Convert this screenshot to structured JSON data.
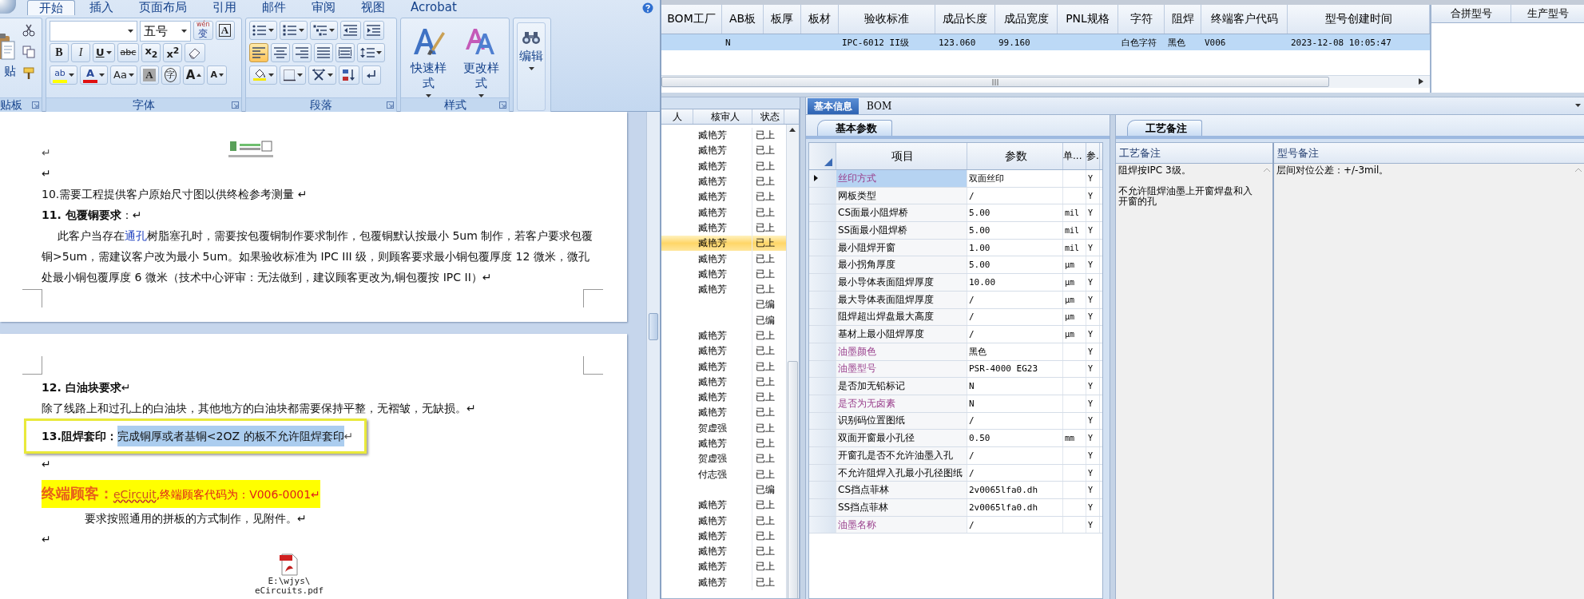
{
  "word": {
    "ribbon": {
      "tabs": [
        {
          "label": "开始",
          "selected": true
        },
        {
          "label": "插入",
          "selected": false
        },
        {
          "label": "页面布局",
          "selected": false
        },
        {
          "label": "引用",
          "selected": false
        },
        {
          "label": "邮件",
          "selected": false
        },
        {
          "label": "审阅",
          "selected": false
        },
        {
          "label": "视图",
          "selected": false
        },
        {
          "label": "Acrobat",
          "selected": false
        }
      ],
      "groups": [
        {
          "kind": "clipboard",
          "label": "贴板",
          "large": [
            {
              "kind": "paste",
              "label": "贴"
            }
          ],
          "rows": [
            {
              "tools": [
                {
                  "kind": "cut"
                }
              ]
            },
            {
              "tools": [
                {
                  "kind": "copy"
                }
              ]
            },
            {
              "tools": [
                {
                  "kind": "painter"
                }
              ]
            }
          ]
        },
        {
          "kind": "font",
          "label": "字体",
          "rows": [
            {
              "tools": [
                {
                  "kind": "field",
                  "dropdown": true
                },
                {
                  "kind": "field",
                  "value": "五号",
                  "dropdown": true
                },
                {
                  "kind": "phonetic",
                  "label": "变",
                  "ruby": "wén",
                  "dropdown": false
                },
                {
                  "kind": "char-border",
                  "label": "A",
                  "dropdown": false
                }
              ]
            },
            {
              "tools": [
                {
                  "kind": "bold",
                  "label": "B",
                  "dropdown": false
                },
                {
                  "kind": "italic",
                  "label": "I",
                  "dropdown": false
                },
                {
                  "kind": "underline",
                  "label": "U",
                  "dropdown": true
                },
                {
                  "kind": "strike",
                  "label": "abc",
                  "dropdown": false
                },
                {
                  "kind": "sub",
                  "label": "x$_{2}$",
                  "dropdown": false
                },
                {
                  "kind": "sup",
                  "label": "x$^{2}$",
                  "dropdown": false
                },
                {
                  "kind": "eraser",
                  "dropdown": false
                }
              ]
            },
            {
              "tools": [
                {
                  "kind": "highlight",
                  "label": "ab",
                  "dropdown": true
                },
                {
                  "kind": "font-color",
                  "label": "A",
                  "dropdown": true
                },
                {
                  "kind": "case",
                  "label": "Aa",
                  "dropdown": true
                },
                {
                  "kind": "shade",
                  "label": "A",
                  "dropdown": false
                },
                {
                  "kind": "enclose",
                  "label": "字",
                  "dropdown": false
                },
                {
                  "kind": "grow",
                  "label": "A",
                  "dropdown": false
                },
                {
                  "kind": "shrink",
                  "label": "A",
                  "dropdown": false
                }
              ]
            }
          ]
        },
        {
          "kind": "paragraph",
          "label": "段落",
          "rows": [
            {
              "tools": [
                {
                  "kind": "bullets",
                  "dropdown": true
                },
                {
                  "kind": "numbering",
                  "dropdown": true
                },
                {
                  "kind": "multilevel",
                  "dropdown": true
                },
                {
                  "kind": "outdent",
                  "dropdown": false
                },
                {
                  "kind": "indent",
                  "dropdown": false
                }
              ]
            },
            {
              "tools": [
                {
                  "kind": "align-left",
                  "dropdown": false,
                  "selected": true
                },
                {
                  "kind": "align-center",
                  "dropdown": false,
                  "selected": false
                },
                {
                  "kind": "align-right",
                  "dropdown": false,
                  "selected": false
                },
                {
                  "kind": "justify",
                  "dropdown": false,
                  "selected": false
                },
                {
                  "kind": "distribute",
                  "dropdown": false,
                  "selected": false
                },
                {
                  "kind": "line-spacing",
                  "dropdown": true
                }
              ]
            },
            {
              "tools": [
                {
                  "kind": "shading",
                  "dropdown": true
                },
                {
                  "kind": "borders",
                  "dropdown": true
                },
                {
                  "kind": "asian-layout",
                  "dropdown": true
                },
                {
                  "kind": "sort",
                  "dropdown": false
                },
                {
                  "kind": "marks",
                  "dropdown": false
                }
              ]
            }
          ]
        },
        {
          "kind": "styles",
          "label": "样式",
          "large": [
            {
              "kind": "quick-styles",
              "label": "快速样式"
            },
            {
              "kind": "change-styles",
              "label": "更改样式"
            }
          ]
        },
        {
          "kind": "editing",
          "large": [
            {
              "kind": "find",
              "label": "编辑"
            }
          ]
        }
      ]
    },
    "pages": [
      {
        "blocks": [
          {
            "kind": "embed",
            "text": "↵"
          },
          {
            "kind": "para",
            "text": "↵"
          },
          {
            "kind": "para",
            "text": "10.需要工程提供客户原始尺寸图以供终检参考测量 ↵"
          },
          {
            "kind": "para",
            "text": "**11. 包覆铜要求**：↵"
          },
          {
            "kind": "link-para",
            "before": "此客户当存在",
            "link": "通孔",
            "after": "树脂塞孔时，需要按包覆铜制作要求制作，包覆铜默认按最小 5um 制作，若客户要求包覆铜>5um，需建议客户改为最小 5um。如果验收标准为 IPC III 级，则顾客要求最小铜包覆厚度 12 微米，微孔处最小铜包覆厚度 6 微米（技术中心评审：无法做到，建议顾客更改为,铜包覆按 IPC II）↵"
          }
        ]
      },
      {
        "blocks": [
          {
            "kind": "para",
            "text": "**12. 白油块要求**↵"
          },
          {
            "kind": "para",
            "text": "除了线路上和过孔上的白油块，其他地方的白油块都需要保持平整，无褶皱，无缺损。↵"
          },
          {
            "kind": "boxed",
            "label": "13.阻焊套印：",
            "selection": "完成铜厚或者基铜<2OZ 的板不允许阻焊套印",
            "end": "↵"
          },
          {
            "kind": "para",
            "text": "↵"
          },
          {
            "kind": "highlight",
            "lead": "终端顾客：",
            "link": "eCircuit",
            "after": ",终端顾客代码为：V006-0001↵"
          },
          {
            "kind": "indented",
            "text": "要求按照通用的拼板的方式制作，见附件。↵"
          },
          {
            "kind": "para",
            "text": "↵"
          },
          {
            "kind": "attachment",
            "lines": [
              "E:\\wjys\\",
              "eCircuits.pdf"
            ]
          }
        ]
      }
    ]
  },
  "grid": {
    "columns": [
      "BOM工厂",
      "AB板",
      "板厚",
      "板材",
      "验收标准",
      "成品长度",
      "成品宽度",
      "PNL规格",
      "字符",
      "阻焊",
      "终端客户代码",
      "型号创建时间"
    ],
    "rows": [
      {
        "selected": true,
        "cells": [
          null,
          "N",
          null,
          null,
          "IPC-6012 II级",
          "123.060",
          "99.160",
          null,
          "白色字符",
          "黑色",
          "V006",
          "2023-12-08 10:05:47"
        ]
      }
    ]
  },
  "side_grid": {
    "columns": [
      "合拼型号",
      "生产型号"
    ]
  },
  "review_list": {
    "columns": [
      "人",
      "核审人",
      "状态"
    ],
    "rows": [
      {
        "reviewer": "臧艳芳",
        "status": "已上",
        "selected": false
      },
      {
        "reviewer": "臧艳芳",
        "status": "已上",
        "selected": false
      },
      {
        "reviewer": "臧艳芳",
        "status": "已上",
        "selected": false
      },
      {
        "reviewer": "臧艳芳",
        "status": "已上",
        "selected": false
      },
      {
        "reviewer": "臧艳芳",
        "status": "已上",
        "selected": false
      },
      {
        "reviewer": "臧艳芳",
        "status": "已上",
        "selected": false
      },
      {
        "reviewer": "臧艳芳",
        "status": "已上",
        "selected": false
      },
      {
        "reviewer": "臧艳芳",
        "status": "已上",
        "selected": true
      },
      {
        "reviewer": "臧艳芳",
        "status": "已上",
        "selected": false
      },
      {
        "reviewer": "臧艳芳",
        "status": "已上",
        "selected": false
      },
      {
        "reviewer": "臧艳芳",
        "status": "已上",
        "selected": false
      },
      {
        "status": "已编",
        "selected": false
      },
      {
        "status": "已编",
        "selected": false
      },
      {
        "reviewer": "臧艳芳",
        "status": "已上",
        "selected": false
      },
      {
        "reviewer": "臧艳芳",
        "status": "已上",
        "selected": false
      },
      {
        "reviewer": "臧艳芳",
        "status": "已上",
        "selected": false
      },
      {
        "reviewer": "臧艳芳",
        "status": "已上",
        "selected": false
      },
      {
        "reviewer": "臧艳芳",
        "status": "已上",
        "selected": false
      },
      {
        "reviewer": "臧艳芳",
        "status": "已上",
        "selected": false
      },
      {
        "reviewer": "贺虚强",
        "status": "已上",
        "selected": false
      },
      {
        "reviewer": "臧艳芳",
        "status": "已上",
        "selected": false
      },
      {
        "reviewer": "贺虚强",
        "status": "已上",
        "selected": false
      },
      {
        "reviewer": "付志强",
        "status": "已上",
        "selected": false
      },
      {
        "status": "已编",
        "selected": false
      },
      {
        "reviewer": "臧艳芳",
        "status": "已上",
        "selected": false
      },
      {
        "reviewer": "臧艳芳",
        "status": "已上",
        "selected": false
      },
      {
        "reviewer": "臧艳芳",
        "status": "已上",
        "selected": false
      },
      {
        "reviewer": "臧艳芳",
        "status": "已上",
        "selected": false
      },
      {
        "reviewer": "臧艳芳",
        "status": "已上",
        "selected": false
      },
      {
        "reviewer": "臧艳芳",
        "status": "已上",
        "selected": false
      }
    ]
  },
  "detail": {
    "tabs": [
      {
        "label": "基本信息",
        "selected": true
      },
      {
        "label": "BOM",
        "selected": false
      }
    ],
    "params": {
      "tab": "基本参数",
      "columns": [
        "项目",
        "参数",
        "单...",
        "参."
      ],
      "rows": [
        {
          "item": "丝印方式",
          "value": "双面丝印",
          "flag": "Y",
          "accent": true,
          "selected": true
        },
        {
          "item": "网板类型",
          "value": "/",
          "flag": "Y",
          "accent": false,
          "selected": false
        },
        {
          "item": "CS面最小阻焊桥",
          "value": "5.00",
          "unit": "mil",
          "flag": "Y",
          "accent": false,
          "selected": false
        },
        {
          "item": "SS面最小阻焊桥",
          "value": "5.00",
          "unit": "mil",
          "flag": "Y",
          "accent": false,
          "selected": false
        },
        {
          "item": "最小阻焊开窗",
          "value": "1.00",
          "unit": "mil",
          "flag": "Y",
          "accent": false,
          "selected": false
        },
        {
          "item": "最小拐角厚度",
          "value": "5.00",
          "unit": "μm",
          "flag": "Y",
          "accent": false,
          "selected": false
        },
        {
          "item": "最小导体表面阻焊厚度",
          "value": "10.00",
          "unit": "μm",
          "flag": "Y",
          "accent": false,
          "selected": false
        },
        {
          "item": "最大导体表面阻焊厚度",
          "value": "/",
          "unit": "μm",
          "flag": "Y",
          "accent": false,
          "selected": false
        },
        {
          "item": "阻焊超出焊盘最大高度",
          "value": "/",
          "unit": "μm",
          "flag": "Y",
          "accent": false,
          "selected": false
        },
        {
          "item": "基材上最小阻焊厚度",
          "value": "/",
          "unit": "μm",
          "flag": "Y",
          "accent": false,
          "selected": false
        },
        {
          "item": "油墨颜色",
          "value": "黑色",
          "flag": "Y",
          "accent": true,
          "selected": false
        },
        {
          "item": "油墨型号",
          "value": "PSR-4000 EG23",
          "flag": "Y",
          "accent": true,
          "selected": false
        },
        {
          "item": "是否加无铅标记",
          "value": "N",
          "flag": "Y",
          "accent": false,
          "selected": false
        },
        {
          "item": "是否为无卤素",
          "value": "N",
          "flag": "Y",
          "accent": true,
          "selected": false
        },
        {
          "item": "识别码位置图纸",
          "value": "/",
          "flag": "Y",
          "accent": false,
          "selected": false
        },
        {
          "item": "双面开窗最小孔径",
          "value": "0.50",
          "unit": "mm",
          "flag": "Y",
          "accent": false,
          "selected": false
        },
        {
          "item": "开窗孔是否不允许油墨入孔",
          "value": "/",
          "flag": "Y",
          "accent": false,
          "selected": false
        },
        {
          "item": "不允许阻焊入孔最小孔径图纸",
          "value": "/",
          "flag": "Y",
          "accent": false,
          "selected": false
        },
        {
          "item": "CS挡点菲林",
          "value": "2v0065lfa0.dh",
          "flag": "Y",
          "accent": false,
          "selected": false
        },
        {
          "item": "SS挡点菲林",
          "value": "2v0065lfa0.dh",
          "flag": "Y",
          "accent": false,
          "selected": false
        },
        {
          "item": "油墨名称",
          "value": "/",
          "flag": "Y",
          "accent": true,
          "selected": false
        }
      ]
    },
    "remarks": {
      "tab": "工艺备注",
      "columns": [
        {
          "title": "工艺备注",
          "paragraphs": [
            "阻焊按IPC 3级。",
            "不允许阻焊油墨上开窗焊盘和入开窗的孔"
          ]
        },
        {
          "title": "型号备注",
          "paragraphs": [
            "层间对位公差：+/-3mil。"
          ]
        }
      ]
    }
  }
}
